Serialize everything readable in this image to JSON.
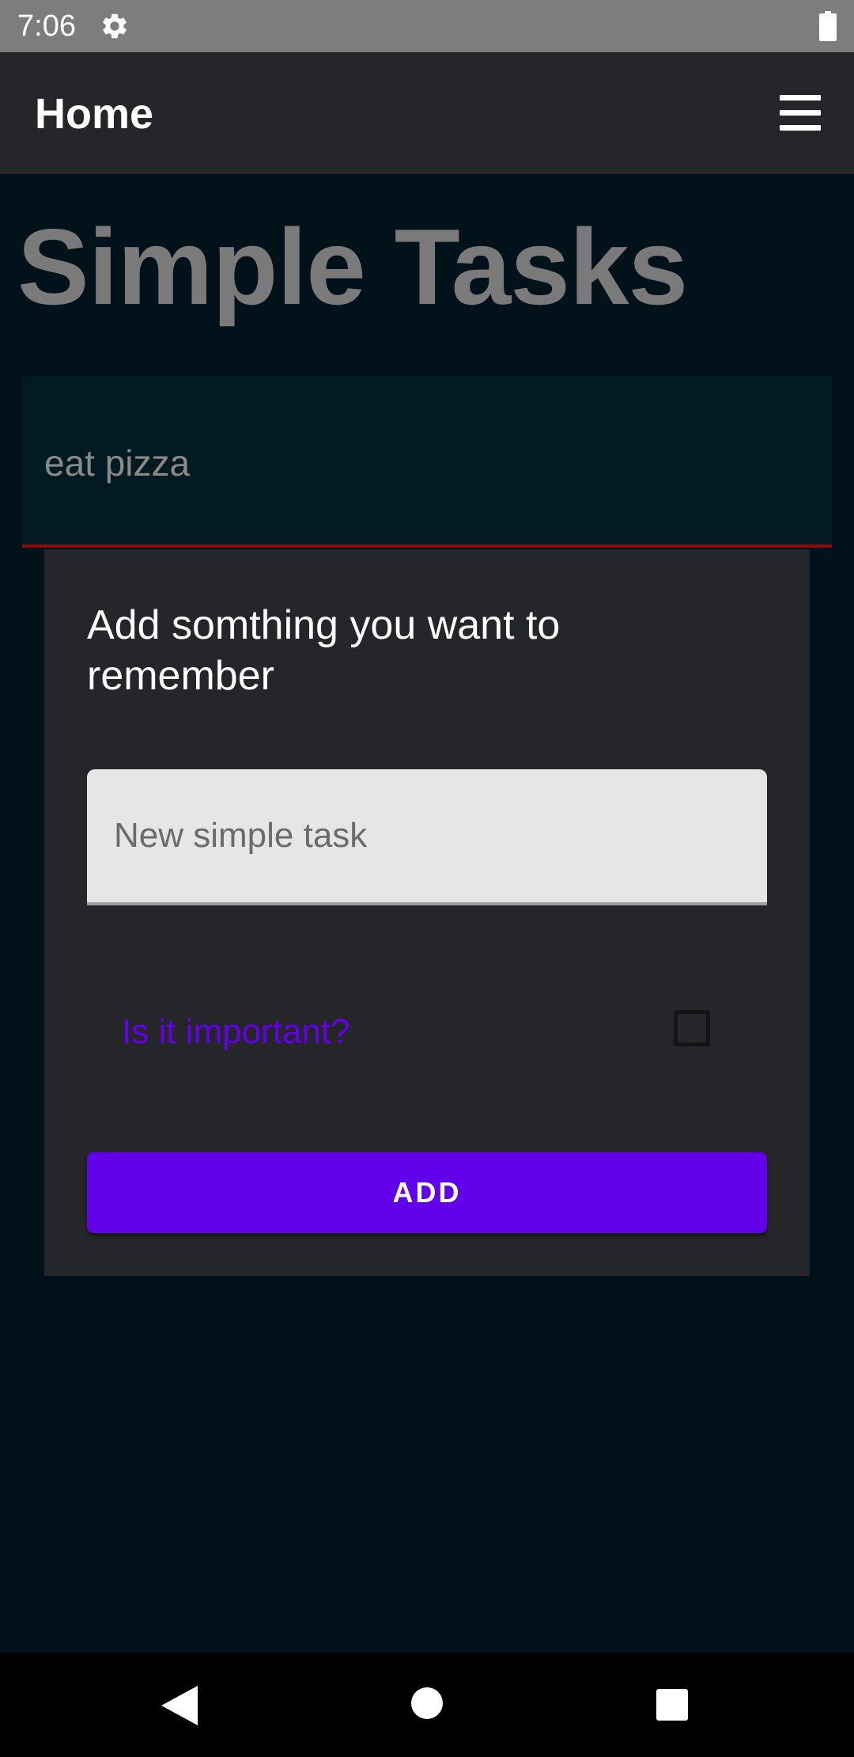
{
  "status_bar": {
    "time": "7:06",
    "settings_icon": "gear-icon",
    "battery_icon": "battery-icon"
  },
  "app_bar": {
    "title": "Home",
    "menu_icon": "hamburger-menu-icon"
  },
  "main": {
    "title": "Simple Tasks",
    "tasks": [
      {
        "text": "eat pizza"
      }
    ]
  },
  "dialog": {
    "title": "Add somthing you want to remember",
    "input": {
      "value": "",
      "placeholder": "New simple task"
    },
    "important_label": "Is it important?",
    "important_checked": false,
    "add_button_label": "ADD"
  },
  "nav_bar": {
    "back_icon": "back-triangle-icon",
    "home_icon": "home-circle-icon",
    "recents_icon": "recents-square-icon"
  },
  "colors": {
    "background": "#02121b",
    "app_bar": "#252629",
    "accent": "#6200ea",
    "task_underline": "#8b0d0d"
  }
}
